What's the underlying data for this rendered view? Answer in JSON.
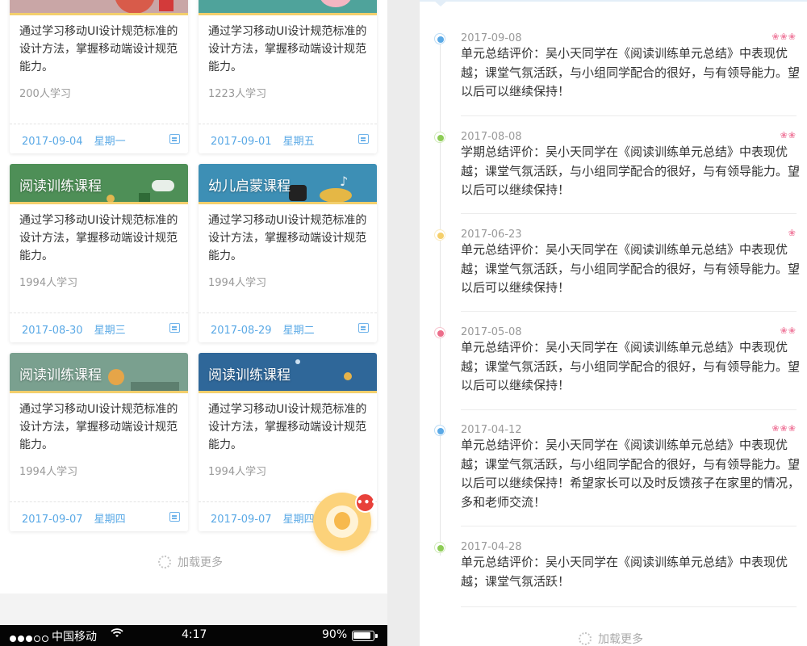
{
  "courses": [
    {
      "title": "",
      "desc": "通过学习移动UI设计规范标准的设计方法，掌握移动端设计规范能力。",
      "count": "200人学习",
      "date": "2017-09-04",
      "week": "星期一"
    },
    {
      "title": "",
      "desc": "通过学习移动UI设计规范标准的设计方法，掌握移动端设计规范能力。",
      "count": "1223人学习",
      "date": "2017-09-01",
      "week": "星期五"
    },
    {
      "title": "阅读训练课程",
      "desc": "通过学习移动UI设计规范标准的设计方法，掌握移动端设计规范能力。",
      "count": "1994人学习",
      "date": "2017-08-30",
      "week": "星期三"
    },
    {
      "title": "幼儿启蒙课程",
      "desc": "通过学习移动UI设计规范标准的设计方法，掌握移动端设计规范能力。",
      "count": "1994人学习",
      "date": "2017-08-29",
      "week": "星期二"
    },
    {
      "title": "阅读训练课程",
      "desc": "通过学习移动UI设计规范标准的设计方法，掌握移动端设计规范能力。",
      "count": "1994人学习",
      "date": "2017-09-07",
      "week": "星期四"
    },
    {
      "title": "阅读训练课程",
      "desc": "通过学习移动UI设计规范标准的设计方法，掌握移动端设计规范能力。",
      "count": "1994人学习",
      "date": "2017-09-07",
      "week": "星期四"
    }
  ],
  "left_load_more": "加载更多",
  "cs_badge": "•••",
  "status_bar": {
    "carrier": "中国移动",
    "time": "4:17",
    "battery": "90%",
    "battery_level": 0.9
  },
  "evaluations": [
    {
      "date": "2017-09-08",
      "flowers": "❀❀❀",
      "color": "#5aa9e6",
      "text": "单元总结评价：吴小天同学在《阅读训练单元总结》中表现优越；课堂气氛活跃，与小组同学配合的很好，与有领导能力。望以后可以继续保持！"
    },
    {
      "date": "2017-08-08",
      "flowers": "❀❀",
      "color": "#8dcc55",
      "text": "学期总结评价：吴小天同学在《阅读训练单元总结》中表现优越；课堂气氛活跃，与小组同学配合的很好，与有领导能力。望以后可以继续保持！"
    },
    {
      "date": "2017-06-23",
      "flowers": "❀",
      "color": "#f5cf6a",
      "text": "单元总结评价：吴小天同学在《阅读训练单元总结》中表现优越；课堂气氛活跃，与小组同学配合的很好，与有领导能力。望以后可以继续保持！"
    },
    {
      "date": "2017-05-08",
      "flowers": "❀❀",
      "color": "#ec6d8a",
      "text": "单元总结评价：吴小天同学在《阅读训练单元总结》中表现优越；课堂气氛活跃，与小组同学配合的很好，与有领导能力。望以后可以继续保持！"
    },
    {
      "date": "2017-04-12",
      "flowers": "❀❀❀",
      "color": "#5aa9e6",
      "text": "单元总结评价：吴小天同学在《阅读训练单元总结》中表现优越；课堂气氛活跃，与小组同学配合的很好，与有领导能力。望以后可以继续保持！希望家长可以及时反馈孩子在家里的情况，多和老师交流！"
    },
    {
      "date": "2017-04-28",
      "flowers": "",
      "color": "#8dcc55",
      "text": "单元总结评价：吴小天同学在《阅读训练单元总结》中表现优越；课堂气氛活跃！"
    }
  ],
  "right_load_more": "加载更多",
  "icons": {
    "calendar": "calendar-icon",
    "wifi": "wifi-icon",
    "spinner": "loading-spinner-icon",
    "cs": "customer-service-icon",
    "flower": "flower-icon"
  }
}
